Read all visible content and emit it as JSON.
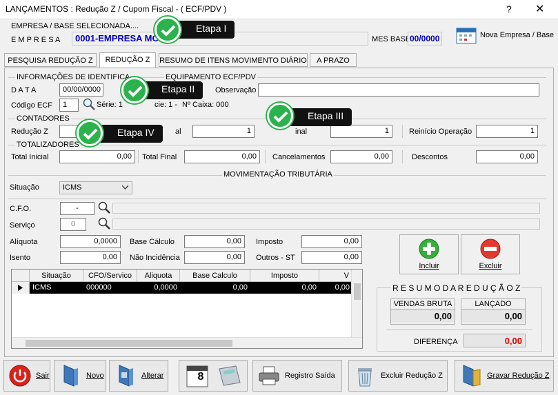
{
  "window": {
    "title": "LANÇAMENTOS : Redução Z / Cupom Fiscal - ( ECF/PDV )",
    "help": "?",
    "close": "✕"
  },
  "empresa": {
    "section_label": "EMPRESA  /  BASE  SELECIONADA....",
    "label": "E  M  P  R  E  S  A",
    "value": "0001-EMPRESA MO",
    "mes_base_label": "MES BASE",
    "mes_base_value": "00/0000",
    "nova_button": "Nova Empresa / Base"
  },
  "tabs": [
    "PESQUISA REDUÇÃO Z",
    "REDUÇÃO Z",
    "RESUMO DE ITENS MOVIMENTO DIÁRIO",
    "A PRAZO"
  ],
  "identificacao": {
    "title": "INFORMAÇÕES DE IDENTIFICA",
    "title2": "EQUIPAMENTO ECF/PDV",
    "data_label": "D A T A",
    "data_value": "00/00/0000",
    "obs_label": "Observação",
    "obs_value": "",
    "ecf_label": "Código ECF",
    "ecf_value": "1",
    "serie_text": "Série: 1",
    "contador_text": "cie: 1  -",
    "caixa_text": "Nº Caixa: 000"
  },
  "contadores": {
    "title": "CONTADORES",
    "reducao_label": "Redução Z",
    "reducao_value": "",
    "final_label": "al",
    "final_value": "1",
    "final2_label": "inal",
    "final2_value": "1",
    "reinicio_label": "Reinício Operação",
    "reinicio_value": "1"
  },
  "totalizadores": {
    "title": "TOTALIZADORES",
    "inicial_label": "Total Inicial",
    "inicial_value": "0,00",
    "final_label": "Total Final",
    "final_value": "0,00",
    "cancel_label": "Cancelamentos",
    "cancel_value": "0,00",
    "desc_label": "Descontos",
    "desc_value": "0,00"
  },
  "movimentacao": {
    "title": "MOVIMENTAÇÃO TRIBUTÁRIA",
    "situacao_label": "Situação",
    "situacao_value": "ICMS",
    "cfo_label": "C.F.O.",
    "cfo_value": "-",
    "servico_label": "Serviço",
    "servico_value": "0",
    "aliquota_label": "Alíquota",
    "aliquota_value": "0,0000",
    "base_label": "Base Cálculo",
    "base_value": "0,00",
    "imposto_label": "Imposto",
    "imposto_value": "0,00",
    "isento_label": "Isento",
    "isento_value": "0,00",
    "naoinc_label": "Não Incidência",
    "naoinc_value": "0,00",
    "outros_label": "Outros - ST",
    "outros_value": "0,00",
    "incluir": "Incluir",
    "excluir": "Excluir"
  },
  "grid": {
    "headers": [
      "Situação",
      "CFO/Servico",
      "Aliquota",
      "Base Calculo",
      "Imposto",
      "V"
    ],
    "row": [
      "ICMS",
      "000000",
      "0,0000",
      "0,00",
      "0,00",
      "0,00"
    ]
  },
  "resumo": {
    "title": "R E S U M O    D A    R E D U Ç Ã O   Z",
    "vendas_label": "VENDAS BRUTA",
    "vendas_value": "0,00",
    "lancado_label": "LANÇADO",
    "lancado_value": "0,00",
    "diferenca_label": "DIFERENÇA",
    "diferenca_value": "0,00"
  },
  "callouts": [
    "Etapa I",
    "Etapa II",
    "Etapa III",
    "Etapa IV"
  ],
  "calendar_day": "8",
  "footer": {
    "sair": "Sair",
    "novo": "Novo",
    "alterar": "Alterar",
    "registro": "Registro Saída",
    "excluir": "Excluir Redução Z",
    "gravar": "Gravar Redução Z"
  },
  "colors": {
    "accent": "#0000c0",
    "check": "#2bb24c",
    "red": "#e00000"
  }
}
